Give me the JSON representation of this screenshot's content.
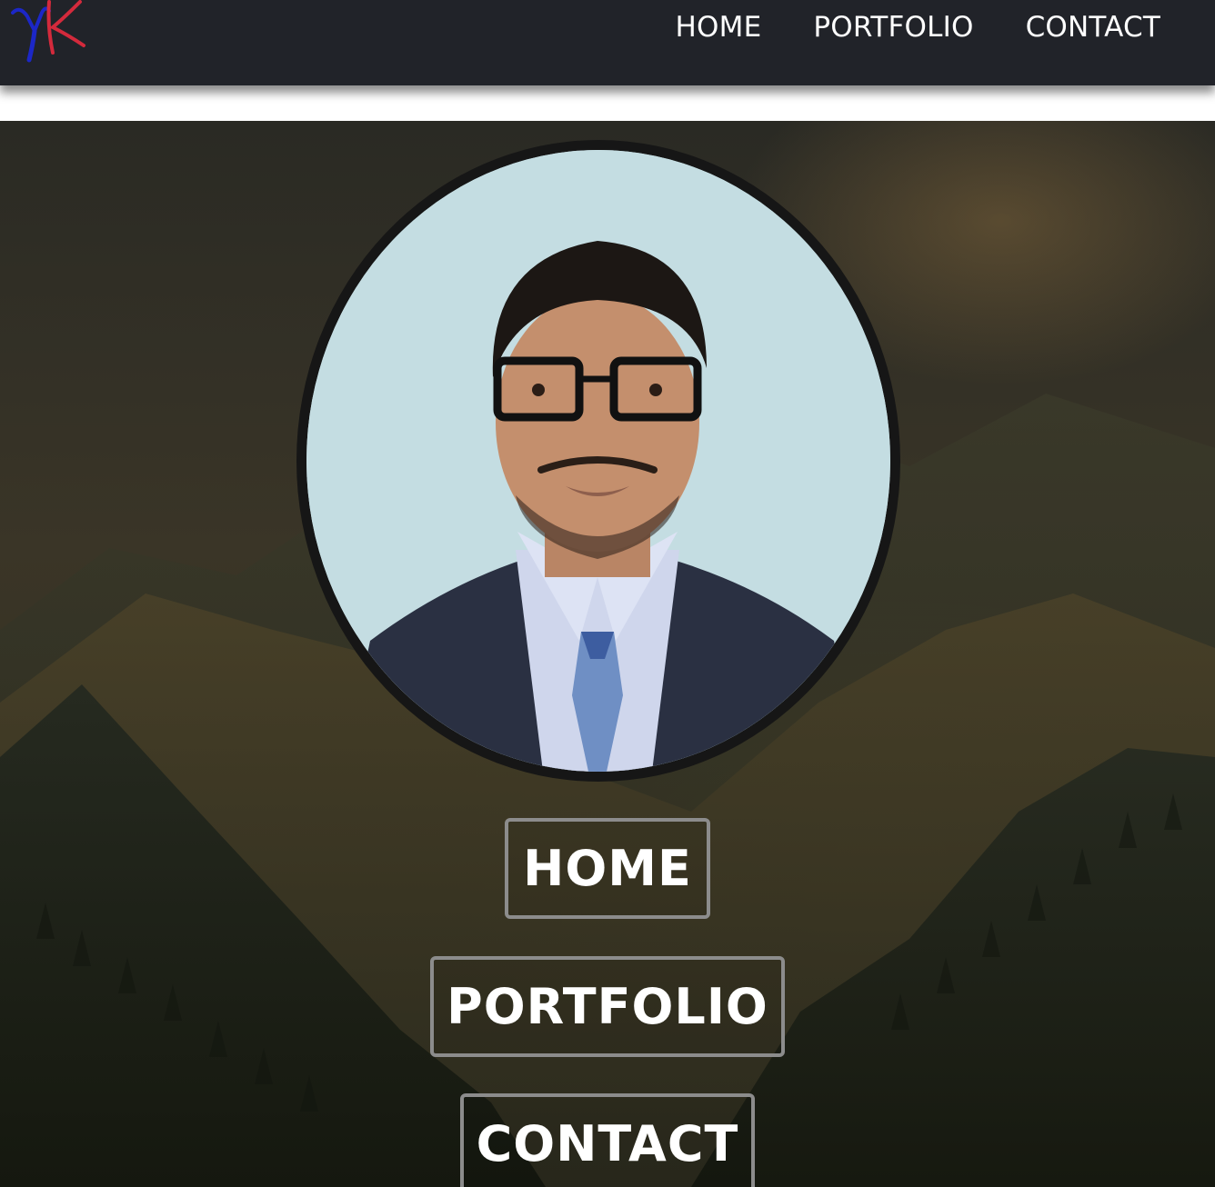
{
  "header": {
    "logo": {
      "icon": "yk-monogram-logo",
      "colors": {
        "y": "#1c27c7",
        "k": "#d42a3c"
      }
    },
    "nav": [
      {
        "label": "HOME"
      },
      {
        "label": "PORTFOLIO"
      },
      {
        "label": "CONTACT"
      }
    ]
  },
  "hero": {
    "background": "mountain-forest-photo",
    "profile_photo": {
      "icon": "profile-portrait"
    },
    "buttons": [
      {
        "label": "HOME"
      },
      {
        "label": "PORTFOLIO"
      },
      {
        "label": "CONTACT"
      }
    ]
  },
  "colors": {
    "topbar": "#212329",
    "button_border": "#8c8c8c",
    "text": "#ffffff"
  }
}
